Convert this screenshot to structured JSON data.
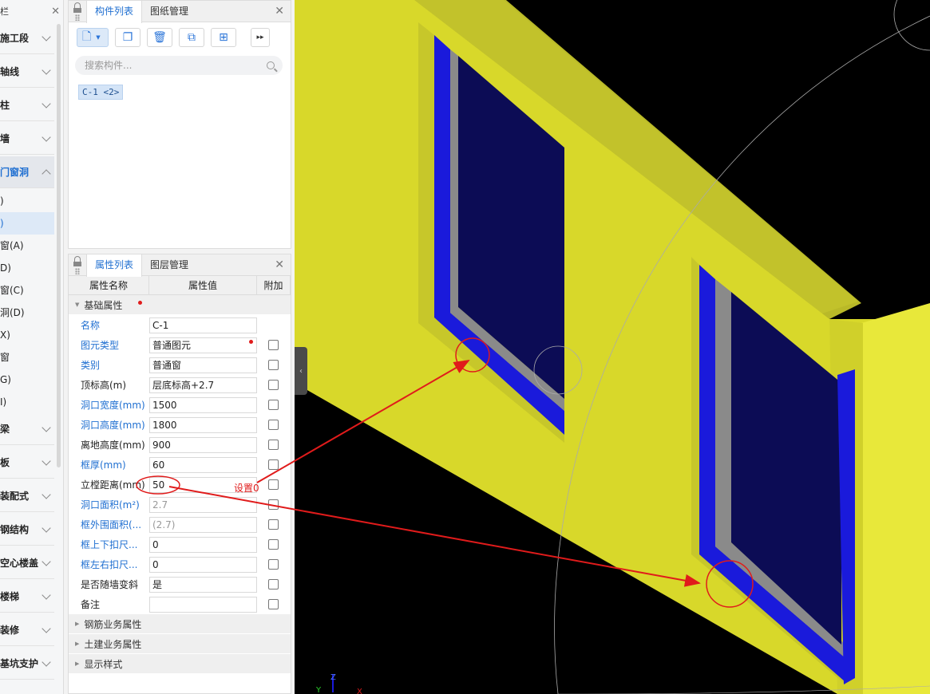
{
  "nav": {
    "header": "栏",
    "items": [
      {
        "label": "施工段"
      },
      {
        "label": "轴线"
      },
      {
        "label": "柱"
      },
      {
        "label": "墙"
      },
      {
        "label": "门窗洞"
      },
      {
        "label": "梁"
      },
      {
        "label": "板"
      },
      {
        "label": "装配式"
      },
      {
        "label": "钢结构"
      },
      {
        "label": "空心楼盖"
      },
      {
        "label": "楼梯"
      },
      {
        "label": "装修"
      },
      {
        "label": "基坑支护"
      }
    ],
    "subitems": [
      ")",
      ")",
      "窗(A)",
      "D)",
      "窗(C)",
      "洞(D)",
      "X)",
      "窗",
      "G)",
      "I)"
    ]
  },
  "component_panel": {
    "tabs": [
      "构件列表",
      "图纸管理"
    ],
    "search_placeholder": "搜索构件...",
    "item": "C-1 <2>"
  },
  "property_panel": {
    "tabs": [
      "属性列表",
      "图层管理"
    ],
    "columns": [
      "属性名称",
      "属性值",
      "附加"
    ],
    "group_basic": "基础属性",
    "rows": [
      {
        "name": "名称",
        "value": "C-1"
      },
      {
        "name": "图元类型",
        "value": "普通图元"
      },
      {
        "name": "类别",
        "value": "普通窗"
      },
      {
        "name": "顶标高(m)",
        "value": "层底标高+2.7"
      },
      {
        "name": "洞口宽度(mm)",
        "value": "1500"
      },
      {
        "name": "洞口高度(mm)",
        "value": "1800"
      },
      {
        "name": "离地高度(mm)",
        "value": "900"
      },
      {
        "name": "框厚(mm)",
        "value": "60"
      },
      {
        "name": "立樘距离(mm)",
        "value": "50"
      },
      {
        "name": "洞口面积(m²)",
        "value": "2.7"
      },
      {
        "name": "框外围面积(...",
        "value": "(2.7)"
      },
      {
        "name": "框上下扣尺...",
        "value": "0"
      },
      {
        "name": "框左右扣尺...",
        "value": "0"
      },
      {
        "name": "是否随墙变斜",
        "value": "是"
      },
      {
        "name": "备注",
        "value": ""
      }
    ],
    "groups_collapsed": [
      "钢筋业务属性",
      "土建业务属性",
      "显示样式"
    ]
  },
  "annotation": {
    "text": "设置0",
    "color": "#e01b1b"
  },
  "axis": {
    "x": "X",
    "y": "Y",
    "z": "Z"
  },
  "colors": {
    "wall": "#d9d92a",
    "frame": "#1a1adb",
    "glass": "#0c0c55",
    "accent": "#1f6fd1"
  }
}
